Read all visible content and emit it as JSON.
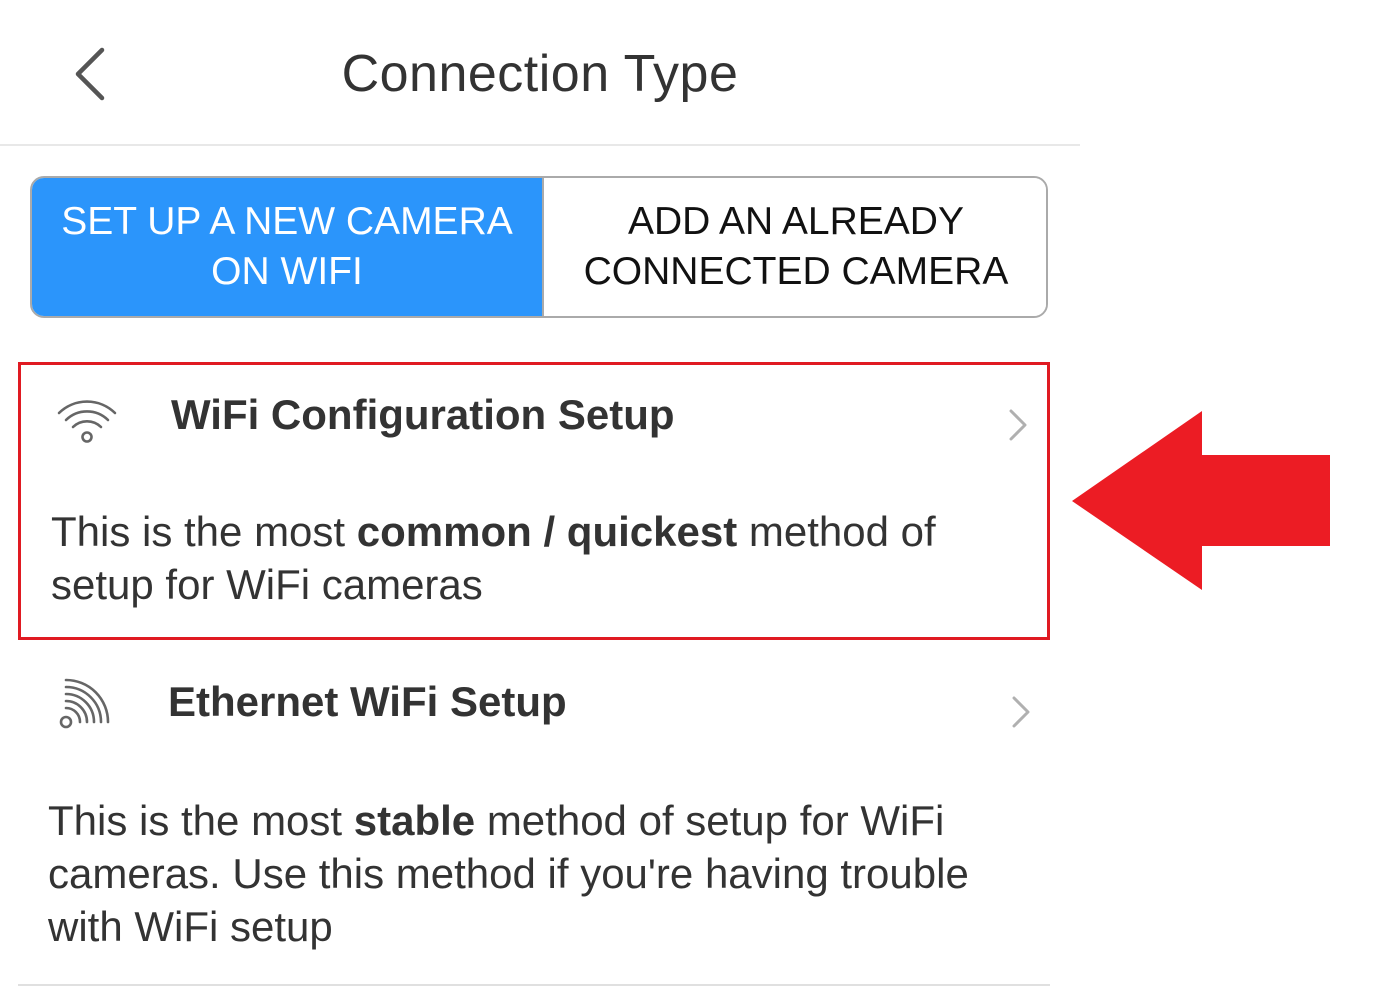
{
  "header": {
    "back_icon": "chevron-left-icon",
    "title": "Connection Type"
  },
  "segmented": {
    "selected": "new",
    "new_camera_line1": "SET UP A NEW CAMERA",
    "new_camera_line2": "ON WIFI",
    "existing_camera_line1": "ADD AN ALREADY",
    "existing_camera_line2": "CONNECTED CAMERA"
  },
  "options": [
    {
      "icon": "wifi-icon",
      "title": "WiFi Configuration Setup",
      "desc_1": "This is the most ",
      "desc_bold_1": "common / quickest",
      "desc_2": " method of setup for WiFi cameras",
      "highlighted": true
    },
    {
      "icon": "ethernet-signal-icon",
      "title": "Ethernet WiFi Setup",
      "desc_1": "This is the most ",
      "desc_bold_1": "stable",
      "desc_2": " method of setup for WiFi cameras. Use this method if you're having trouble with WiFi setup",
      "highlighted": false
    }
  ],
  "colors": {
    "accent_blue": "#2b95fb",
    "highlight_red": "#e01a22",
    "text_dark": "#333333"
  },
  "annotation": {
    "arrow_icon": "left-arrow-icon"
  }
}
